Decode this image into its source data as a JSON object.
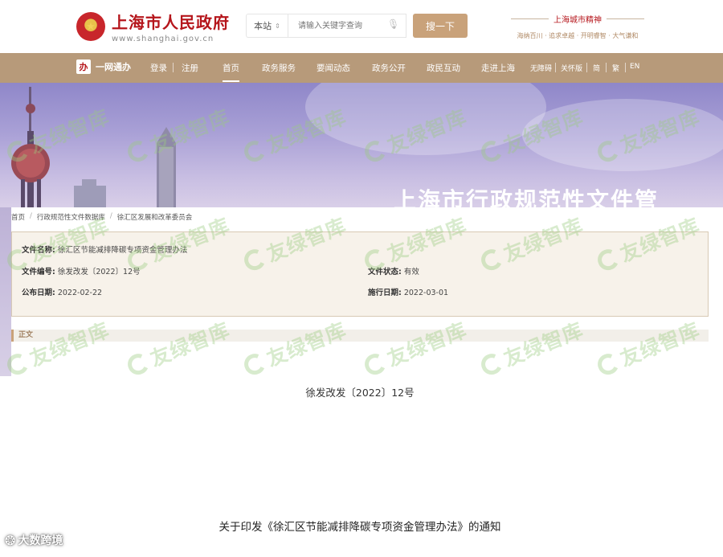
{
  "header": {
    "logo_title": "上海市人民政府",
    "logo_domain": "www.shanghai.gov.cn",
    "search_scope": "本站",
    "search_placeholder": "请输入关键字查询",
    "search_button": "搜一下",
    "spirit_title": "上海城市精神",
    "spirit_motto": "海纳百川 · 追求卓越 · 开明睿智 · 大气谦和"
  },
  "nav": {
    "ywtb": "一网通办",
    "login": "登录",
    "register": "注册",
    "items": [
      "首页",
      "政务服务",
      "要闻动态",
      "政务公开",
      "政民互动",
      "走进上海"
    ],
    "tools": [
      "无障碍",
      "关怀版",
      "简",
      "繁",
      "EN"
    ]
  },
  "banner": {
    "title": "上海市行政规范性文件管"
  },
  "breadcrumb": [
    "首页",
    "行政规范性文件数据库",
    "徐汇区发展和改革委员会"
  ],
  "document": {
    "name_label": "文件名称:",
    "name_value": "徐汇区节能减排降碳专项资金管理办法",
    "number_label": "文件编号:",
    "number_value": "徐发改发〔2022〕12号",
    "status_label": "文件状态:",
    "status_value": "有效",
    "publish_label": "公布日期:",
    "publish_value": "2022-02-22",
    "effective_label": "施行日期:",
    "effective_value": "2022-03-01",
    "body_label": "正文",
    "doc_number": "徐发改发〔2022〕12号",
    "notice_title": "关于印发《徐汇区节能减排降碳专项资金管理办法》的通知"
  },
  "watermark": "友绿智库",
  "corner_watermark": "大数跨境",
  "colors": {
    "brand_red": "#b5151b",
    "nav_gold": "#b79a7a",
    "button_gold": "#c9a27a",
    "meta_bg": "#f7f2ea"
  }
}
